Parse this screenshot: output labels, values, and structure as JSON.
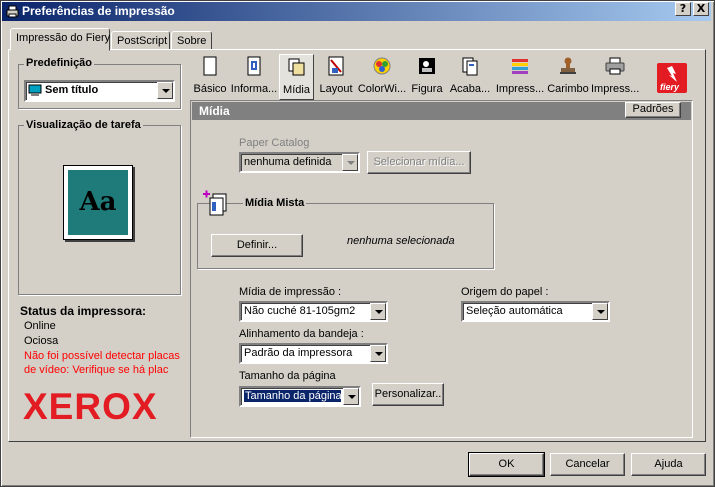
{
  "window": {
    "title": "Preferências de impressão",
    "help_button": "?",
    "close_button": "X"
  },
  "tabs": [
    {
      "label": "Impressão do Fiery",
      "active": true
    },
    {
      "label": "PostScript",
      "active": false
    },
    {
      "label": "Sobre",
      "active": false
    }
  ],
  "preset": {
    "group_label": "Predefinição",
    "value": "Sem título"
  },
  "preview": {
    "group_label": "Visualização de tarefa",
    "sample_text": "Aa",
    "sample_color": "#1f7a7a"
  },
  "printer_status": {
    "heading": "Status da impressora:",
    "lines": [
      "Online",
      "Ociosa"
    ],
    "warning": [
      "Não foi possível detectar placas",
      "de vídeo: Verifique se há plac"
    ],
    "brand": "XEROX",
    "brand_color": "#e31b23"
  },
  "toolbar": {
    "items": [
      {
        "label": "Básico",
        "icon": "blank-page-icon"
      },
      {
        "label": "Informa...",
        "icon": "info-page-icon"
      },
      {
        "label": "Mídia",
        "icon": "media-icon",
        "active": true
      },
      {
        "label": "Layout",
        "icon": "layout-icon"
      },
      {
        "label": "ColorWi...",
        "icon": "colorwise-icon"
      },
      {
        "label": "Figura",
        "icon": "image-icon"
      },
      {
        "label": "Acaba...",
        "icon": "finishing-icon"
      },
      {
        "label": "Impress...",
        "icon": "print-quality-icon"
      },
      {
        "label": "Carimbo",
        "icon": "stamp-icon"
      },
      {
        "label": "Impress...",
        "icon": "printer-icon"
      }
    ],
    "brand_logo": "fiery"
  },
  "section": {
    "title": "Mídia",
    "defaults_button": "Padrões"
  },
  "paper_catalog": {
    "label": "Paper Catalog",
    "value": "nenhuma definida",
    "select_button": "Selecionar mídia..."
  },
  "mixed_media": {
    "group_label": "Mídia Mista",
    "define_button": "Definir...",
    "status": "nenhuma selecionada"
  },
  "print_media": {
    "label": "Mídia de impressão :",
    "value": "Não cuché 81-105gm2"
  },
  "paper_source": {
    "label": "Origem do papel :",
    "value": "Seleção automática"
  },
  "tray_alignment": {
    "label": "Alinhamento da bandeja :",
    "value": "Padrão da impressora"
  },
  "page_size": {
    "label": "Tamanho da página",
    "value": "Tamanho da página",
    "custom_button": "Personalizar.."
  },
  "footer": {
    "ok": "OK",
    "cancel": "Cancelar",
    "help": "Ajuda"
  }
}
